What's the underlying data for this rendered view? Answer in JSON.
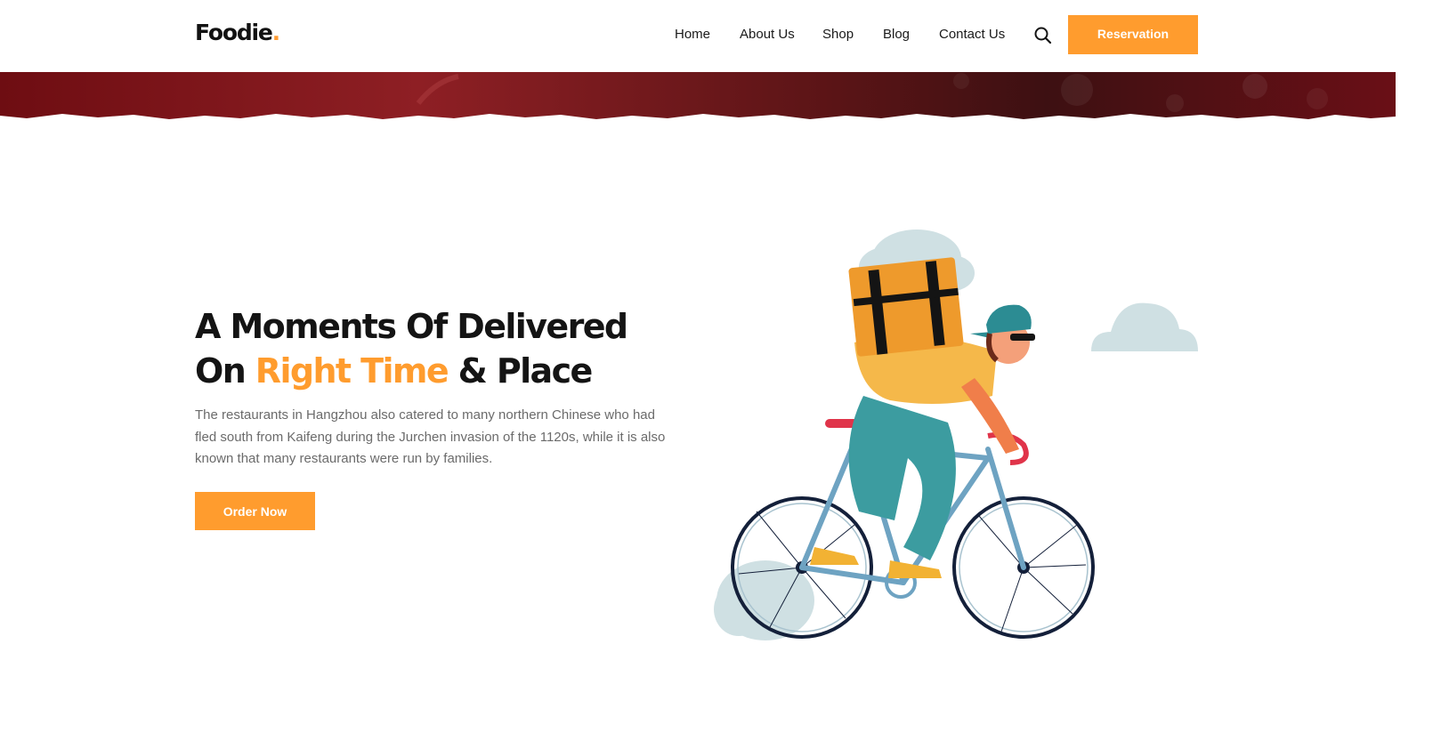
{
  "brand": {
    "name": "Foodie",
    "dot": "."
  },
  "nav": {
    "items": [
      {
        "label": "Home"
      },
      {
        "label": "About Us"
      },
      {
        "label": "Shop"
      },
      {
        "label": "Blog"
      },
      {
        "label": "Contact Us"
      }
    ],
    "search_icon": "search-icon",
    "reservation_label": "Reservation"
  },
  "hero": {
    "title_line1": "A Moments Of Delivered",
    "title_line2_prefix": "On ",
    "title_line2_accent": "Right Time",
    "title_line2_suffix": " & Place",
    "description": "The restaurants in Hangzhou also catered to many northern Chinese who had fled south from Kaifeng during the Jurchen invasion of the 1120s, while it is also known that many restaurants were run by families.",
    "cta_label": "Order Now"
  },
  "colors": {
    "accent": "#ff9c2e",
    "band_red": "#8e1f24",
    "text_dark": "#141414",
    "text_muted": "#6b6b6b"
  }
}
